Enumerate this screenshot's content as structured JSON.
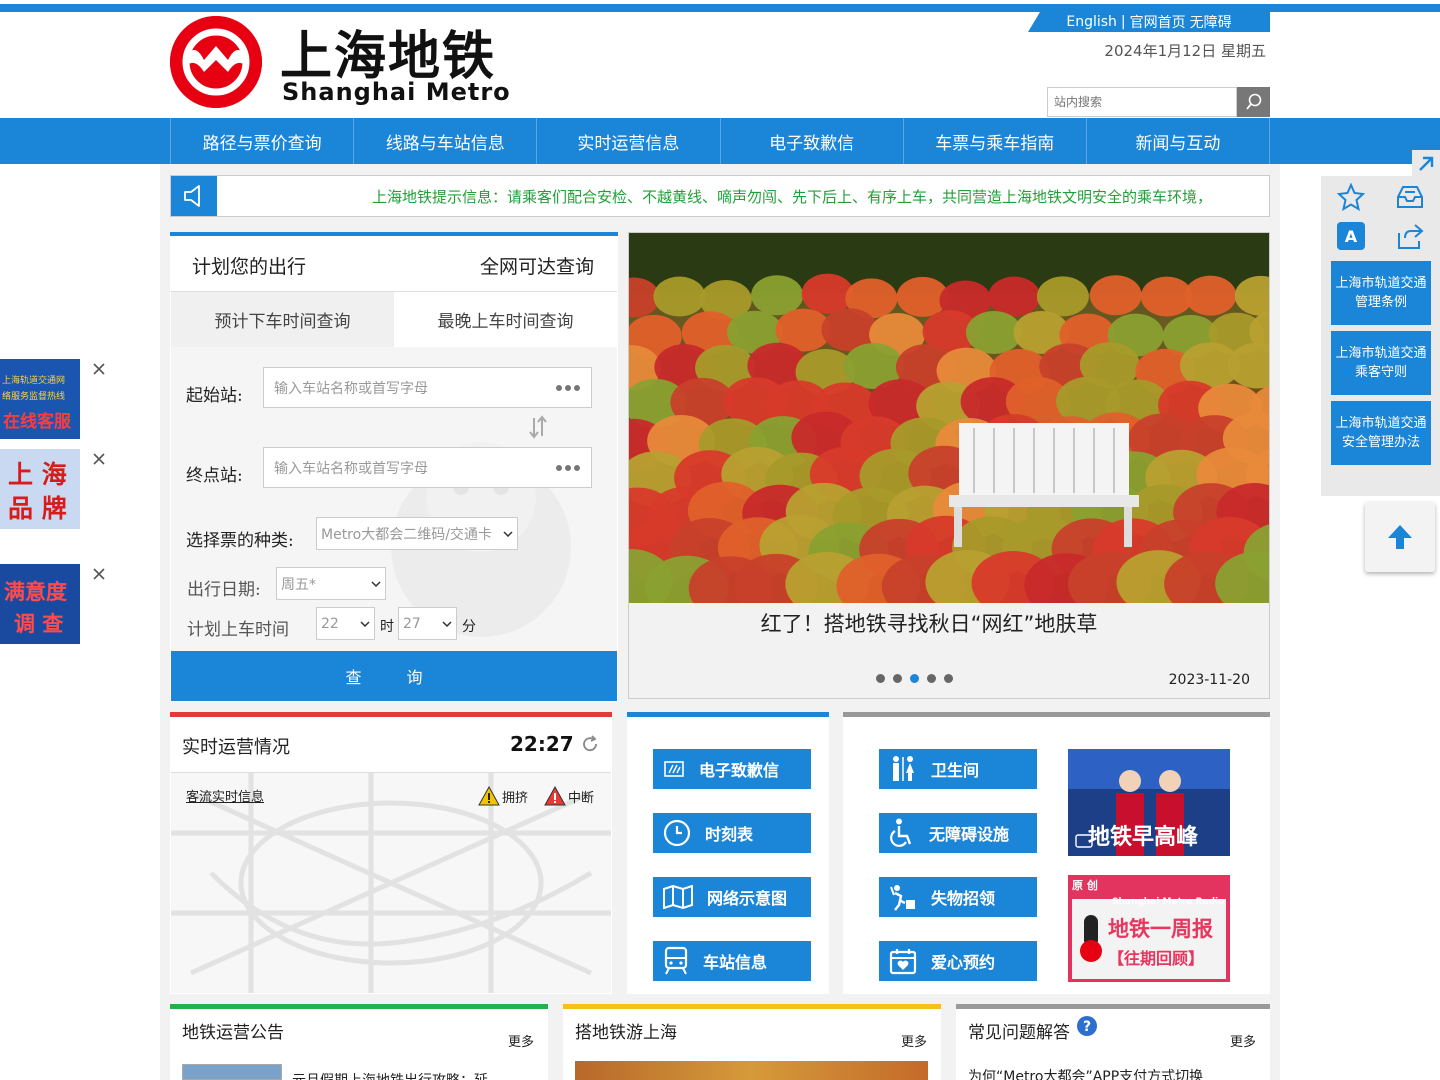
{
  "header": {
    "top_links": [
      "English",
      "|",
      "官网首页",
      "无障碍"
    ],
    "date": "2024年1月12日 星期五",
    "logo_cn": "上海地铁",
    "logo_en": "Shanghai Metro",
    "search_placeholder": "站内搜索"
  },
  "nav": [
    "路径与票价查询",
    "线路与车站信息",
    "实时运营信息",
    "电子致歉信",
    "车票与乘车指南",
    "新闻与互动"
  ],
  "notice": "上海地铁提示信息：请乘客们配合安检、不越黄线、嘀声勿闯、先下后上、有序上车，共同营造上海地铁文明安全的乘车环境，",
  "trip": {
    "title": "计划您的出行",
    "all_network": "全网可达查询",
    "tabs": [
      "预计下车时间查询",
      "最晚上车时间查询"
    ],
    "start_label": "起始站:",
    "end_label": "终点站:",
    "station_placeholder": "输入车站名称或首写字母",
    "ticket_label": "选择票的种类:",
    "ticket_value": "Metro大都会二维码/交通卡",
    "date_label": "出行日期:",
    "date_value": "周五*",
    "time_label": "计划上车时间",
    "hour": "22",
    "hour_unit": "时",
    "minute": "27",
    "minute_unit": "分",
    "query": "查 询"
  },
  "banner": {
    "caption": "红了！搭地铁寻找秋日“网红”地肤草",
    "date": "2023-11-20",
    "dot_count": 5,
    "active_dot": 2
  },
  "realtime": {
    "title": "实时运营情况",
    "time": "22:27",
    "link": "客流实时信息",
    "legend_crowded": "拥挤",
    "legend_interrupted": "中断"
  },
  "services_left": [
    {
      "label": "电子致歉信",
      "icon": "letter-icon"
    },
    {
      "label": "时刻表",
      "icon": "clock-icon"
    },
    {
      "label": "网络示意图",
      "icon": "map-icon"
    },
    {
      "label": "车站信息",
      "icon": "train-icon"
    }
  ],
  "services_right": [
    {
      "label": "卫生间",
      "icon": "restroom-icon"
    },
    {
      "label": "无障碍设施",
      "icon": "wheelchair-icon"
    },
    {
      "label": "失物招领",
      "icon": "lost-found-icon"
    },
    {
      "label": "爱心预约",
      "icon": "calendar-heart-icon"
    }
  ],
  "thumbs": {
    "t1_text": "地铁早高峰",
    "t2_badge": "原 创",
    "t2_radio": "Shanghai Metro Radio",
    "t2_title": "地铁一周报",
    "t2_sub": "【往期回顾】"
  },
  "sections": [
    {
      "title": "地铁运营公告",
      "more": "更多",
      "item": "元旦假期上海地铁出行攻略：延"
    },
    {
      "title": "搭地铁游上海",
      "more": "更多"
    },
    {
      "title": "常见问题解答",
      "more": "更多",
      "item": "为何“Metro大都会”APP支付方式切换"
    }
  ],
  "side_ads": [
    {
      "line1": "上海轨道交通网",
      "line2": "络服务监督热线",
      "line3": "在线客服"
    },
    {
      "line1": "上 海",
      "line2": "品 牌"
    },
    {
      "line1": "满意度",
      "line2": "调 查"
    }
  ],
  "right_panel": [
    "上海市轨道交通管理条例",
    "上海市轨道交通乘客守则",
    "上海市轨道交通安全管理办法"
  ],
  "right_icon_letter": "A",
  "colors": {
    "brand_blue": "#1b85d8",
    "metro_red": "#e60012",
    "notice_green": "#21a038"
  }
}
